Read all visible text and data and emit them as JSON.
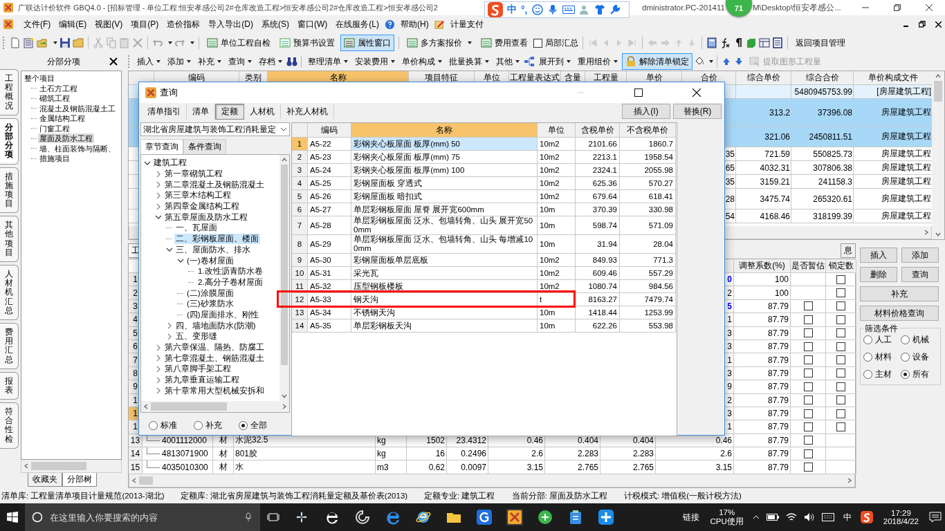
{
  "title_bar": {
    "title": "广联达计价软件 GBQ4.0 - [招标管理 - 单位工程:恒安孝感公司2#仓库改造工程>恒安孝感公司2#仓库改造工程>恒安孝感公司2",
    "title_tail": "dministrator.PC-201411",
    "title_end": "M\\Desktop\\恒安孝感公..."
  },
  "ime_toolbar": {
    "mode": "中",
    "punctuation": "°,"
  },
  "badge": "71",
  "menu": [
    "文件(F)",
    "编辑(E)",
    "视图(V)",
    "项目(P)",
    "造价指标",
    "导入导出(D)",
    "系统(S)",
    "窗口(W)",
    "在线服务(L)",
    "帮助(H)",
    "计量支付"
  ],
  "toolbar": [
    {
      "label": "单位工程自检",
      "pressed": false
    },
    {
      "label": "预算书设置",
      "pressed": false
    },
    {
      "label": "属性窗口",
      "pressed": true
    },
    {
      "label": "多方案报价",
      "pressed": false
    },
    {
      "label": "费用查看",
      "pressed": false
    }
  ],
  "partial_summary": {
    "label": "局部汇总",
    "checked": false
  },
  "return_button": "返回项目管理",
  "left_panel": {
    "title": "分部分项",
    "tree": [
      {
        "label": "整个项目",
        "selected": false,
        "children": [
          {
            "label": "土石方工程",
            "selected": false
          },
          {
            "label": "砌筑工程",
            "selected": false
          },
          {
            "label": "混凝土及钢筋混凝土工",
            "selected": false
          },
          {
            "label": "金属结构工程",
            "selected": false
          },
          {
            "label": "门窗工程",
            "selected": false
          },
          {
            "label": "屋面及防水工程",
            "selected": true
          },
          {
            "label": "墙、柱面装饰与隔断、",
            "selected": false
          },
          {
            "label": "措施项目",
            "selected": false
          }
        ]
      }
    ],
    "bottom_tabs": [
      {
        "label": "收藏夹",
        "selected": false
      },
      {
        "label": "分部树",
        "selected": true
      }
    ]
  },
  "side_tabs": [
    {
      "label": "工程概况",
      "selected": false
    },
    {
      "label": "分部分项",
      "selected": true
    },
    {
      "label": "措施项目",
      "selected": false
    },
    {
      "label": "其他项目",
      "selected": false
    },
    {
      "label": "人材机汇总",
      "selected": false
    },
    {
      "label": "费用汇总",
      "selected": false
    },
    {
      "label": "报表",
      "selected": false
    },
    {
      "label": "符合性检",
      "selected": false
    }
  ],
  "toolbar2": [
    {
      "label": "插入",
      "dropdown": true
    },
    {
      "label": "添加",
      "dropdown": true
    },
    {
      "label": "补充",
      "dropdown": true
    },
    {
      "label": "查询",
      "dropdown": true
    },
    {
      "label": "存档",
      "dropdown": true
    },
    {
      "label": "整理清单",
      "dropdown": true
    },
    {
      "label": "安装费用",
      "dropdown": true
    },
    {
      "label": "单价构成",
      "dropdown": true
    },
    {
      "label": "批量换算",
      "dropdown": true
    },
    {
      "label": "其他",
      "dropdown": true
    },
    {
      "label": "展开到",
      "dropdown": true
    },
    {
      "label": "重用组价",
      "dropdown": true
    }
  ],
  "unlock_button": {
    "label": "解除清单锁定",
    "pressed": true
  },
  "extract_button": {
    "label": "提取图形工程量",
    "disabled": true
  },
  "top_grid": {
    "columns": [
      {
        "label": "编码",
        "selected": false
      },
      {
        "label": "类别",
        "selected": false
      },
      {
        "label": "名称",
        "selected": true
      },
      {
        "label": "项目特征",
        "selected": false
      },
      {
        "label": "单位",
        "selected": false
      },
      {
        "label": "工程量表达式",
        "selected": false
      },
      {
        "label": "含量",
        "selected": false
      },
      {
        "label": "工程量",
        "selected": false
      },
      {
        "label": "单价",
        "selected": false
      },
      {
        "label": "合价",
        "selected": false
      },
      {
        "label": "综合单价",
        "selected": false
      },
      {
        "label": "综合合价",
        "selected": false
      },
      {
        "label": "单价构成文件",
        "selected": false
      }
    ],
    "rows": [
      {
        "kind": "total",
        "selected": false,
        "total": "5480945753.99",
        "file": "[房屋建筑工程]"
      },
      {
        "kind": "item",
        "selected": true,
        "unit_price": "313.2",
        "total": "37396.08",
        "file": "房屋建筑工程"
      },
      {
        "kind": "item",
        "selected": true,
        "unit_price": "321.06",
        "total": "2450811.51",
        "file": "房屋建筑工程"
      },
      {
        "kind": "item",
        "selected": false,
        "amount": "35",
        "unit_price": "721.59",
        "total": "550825.73",
        "file": "房屋建筑工程"
      },
      {
        "kind": "item",
        "selected": false,
        "amount": "65",
        "unit_price": "4032.31",
        "total": "307806.38",
        "file": "房屋建筑工程"
      },
      {
        "kind": "item",
        "selected": false,
        "amount": "35",
        "unit_price": "3159.21",
        "total": "241158.3",
        "file": "房屋建筑工程"
      },
      {
        "kind": "item",
        "selected": false,
        "amount": "28",
        "unit_price": "3475.74",
        "total": "265320.61",
        "file": "房屋建筑工程"
      },
      {
        "kind": "item",
        "selected": false,
        "amount": "54",
        "unit_price": "4168.46",
        "total": "318199.39",
        "file": "房屋建筑工程"
      }
    ]
  },
  "bottom_tabs": [
    {
      "label": "工",
      "selected": true
    },
    {
      "label": "息",
      "selected": false
    }
  ],
  "bottom_grid": {
    "columns": [
      "调整系数(%)",
      "是否暂估",
      "锁定数"
    ],
    "rows": [
      {
        "no": "1",
        "selected": false,
        "tail": "0",
        "changed": true,
        "rate": "100",
        "lock": {
          "checked": false
        }
      },
      {
        "no": "2",
        "selected": false,
        "tail": "2",
        "changed": false,
        "rate": "100",
        "lock": {
          "checked": false
        }
      },
      {
        "no": "3",
        "selected": false,
        "tail": "5",
        "changed": true,
        "rate": "87.79",
        "estimate": {
          "checked": false
        },
        "lock": {
          "checked": false
        }
      },
      {
        "no": "4",
        "selected": false,
        "tail": "1",
        "changed": false,
        "rate": "87.79",
        "estimate": {
          "checked": false
        },
        "lock": {
          "checked": false
        }
      },
      {
        "no": "5",
        "selected": false,
        "tail": "3",
        "changed": false,
        "rate": "87.79",
        "estimate": {
          "checked": false
        },
        "lock": {
          "checked": false
        }
      },
      {
        "no": "6",
        "selected": false,
        "tail": "3",
        "changed": false,
        "rate": "87.79",
        "estimate": {
          "checked": false
        },
        "lock": {
          "checked": false
        }
      },
      {
        "no": "7",
        "selected": false,
        "tail": "1",
        "changed": false,
        "rate": "87.79",
        "estimate": {
          "checked": false
        },
        "lock": {
          "checked": false
        }
      },
      {
        "no": "8",
        "selected": false,
        "tail": "3",
        "changed": false,
        "rate": "87.79",
        "estimate": {
          "checked": false
        },
        "lock": {
          "checked": false
        }
      },
      {
        "no": "9",
        "selected": false,
        "tail": "9",
        "changed": false,
        "rate": "87.79",
        "estimate": {
          "checked": false
        },
        "lock": {
          "checked": false
        }
      },
      {
        "no": "1",
        "selected": false,
        "tail": "2",
        "changed": false,
        "rate": "87.79",
        "estimate": {
          "checked": false
        },
        "lock": {
          "checked": false
        }
      },
      {
        "no": "1",
        "selected": true,
        "tail": "3",
        "changed": false,
        "rate": "87.79",
        "estimate": {
          "checked": false
        },
        "lock": {
          "checked": false
        }
      },
      {
        "no": "1",
        "selected": false,
        "tail": "1",
        "changed": false,
        "rate": "87.79",
        "estimate": {
          "checked": false
        },
        "lock": {
          "checked": false
        }
      },
      {
        "no": "13",
        "selected": false,
        "code": "4001112000",
        "type": "材",
        "name": "水泥32.5",
        "unit": "kg",
        "qty": "1502",
        "content": "23.4312",
        "price1": "0.46",
        "price2": "0.404",
        "price3": "0.404",
        "tail": "0.46",
        "changed": false,
        "rate": "87.79",
        "estimate": {
          "checked": false
        }
      },
      {
        "no": "14",
        "selected": false,
        "code": "4813071900",
        "type": "材",
        "name": "801胶",
        "unit": "kg",
        "qty": "16",
        "content": "0.2496",
        "price1": "2.6",
        "price2": "2.283",
        "price3": "2.283",
        "tail": "2.6",
        "changed": false,
        "rate": "87.79",
        "estimate": {
          "checked": false
        }
      },
      {
        "no": "15",
        "selected": false,
        "code": "4035010300",
        "type": "材",
        "name": "水",
        "unit": "m3",
        "qty": "0.62",
        "content": "0.0097",
        "price1": "3.15",
        "price2": "2.765",
        "price3": "2.765",
        "tail": "3.15",
        "changed": false,
        "rate": "87.79",
        "estimate": {
          "checked": false
        }
      }
    ]
  },
  "side_buttons": [
    "插入",
    "添加",
    "删除",
    "查询",
    "补充",
    "材料价格查询"
  ],
  "filter": {
    "title": "筛选条件",
    "options": [
      {
        "label": "人工",
        "selected": false
      },
      {
        "label": "机械",
        "selected": false
      },
      {
        "label": "材料",
        "selected": false
      },
      {
        "label": "设备",
        "selected": false
      },
      {
        "label": "主材",
        "selected": false
      },
      {
        "label": "所有",
        "selected": true
      }
    ]
  },
  "dialog": {
    "title": "查询",
    "tabs": [
      {
        "label": "清单指引",
        "selected": false
      },
      {
        "label": "清单",
        "selected": false
      },
      {
        "label": "定额",
        "selected": true
      },
      {
        "label": "人材机",
        "selected": false
      },
      {
        "label": "补充人材机",
        "selected": false
      }
    ],
    "buttons": [
      "插入(I)",
      "替换(R)"
    ],
    "library": "湖北省房屋建筑与装饰工程消耗量定",
    "search_tabs": [
      {
        "label": "章节查询",
        "selected": true
      },
      {
        "label": "条件查询",
        "selected": false
      }
    ],
    "tree": [
      {
        "label": "建筑工程",
        "expanded": true,
        "selected": false,
        "children": [
          {
            "label": "第一章砌筑工程",
            "expanded": false,
            "selected": false
          },
          {
            "label": "第二章混凝土及钢筋混凝土",
            "expanded": false,
            "selected": false
          },
          {
            "label": "第三章木结构工程",
            "expanded": false,
            "selected": false
          },
          {
            "label": "第四章金属结构工程",
            "expanded": false,
            "selected": false
          },
          {
            "label": "第五章屋面及防水工程",
            "expanded": true,
            "selected": false,
            "children": [
              {
                "label": "一、瓦屋面",
                "selected": false
              },
              {
                "label": "二、彩钢板屋面、楼面",
                "selected": true
              },
              {
                "label": "三、屋面防水、排水",
                "expanded": true,
                "selected": false,
                "children": [
                  {
                    "label": "(一)卷材屋面",
                    "expanded": true,
                    "selected": false,
                    "children": [
                      {
                        "label": "1.改性沥青防水卷",
                        "selected": false
                      },
                      {
                        "label": "2.高分子卷材屋面",
                        "selected": false
                      }
                    ]
                  },
                  {
                    "label": "(二)涂膜屋面",
                    "selected": false
                  },
                  {
                    "label": "(三)砂浆防水",
                    "selected": false
                  },
                  {
                    "label": "(四)屋面排水、刚性",
                    "selected": false
                  }
                ]
              },
              {
                "label": "四、墙地面防水(防潮)",
                "expanded": false,
                "selected": false
              },
              {
                "label": "五、变形缝",
                "expanded": false,
                "selected": false
              }
            ]
          },
          {
            "label": "第六章保温、隔热、防腐工",
            "expanded": false,
            "selected": false
          },
          {
            "label": "第七章混凝土、钢筋混凝土",
            "expanded": false,
            "selected": false
          },
          {
            "label": "第八章脚手架工程",
            "expanded": false,
            "selected": false
          },
          {
            "label": "第九章垂直运输工程",
            "expanded": false,
            "selected": false
          },
          {
            "label": "第十章常用大型机械安拆和",
            "expanded": false,
            "selected": false
          }
        ]
      }
    ],
    "scope": [
      {
        "label": "标准",
        "selected": false
      },
      {
        "label": "补充",
        "selected": false
      },
      {
        "label": "全部",
        "selected": true
      }
    ],
    "table": {
      "columns": [
        "编码",
        "名称",
        "单位",
        "含税单价",
        "不含税单价"
      ],
      "rows": [
        {
          "no": "1",
          "code": "A5-22",
          "name": "彩钢夹心板屋面 板厚(mm) 50",
          "unit": "10m2",
          "price_tax": "2101.66",
          "price": "1860.7",
          "selected": true
        },
        {
          "no": "2",
          "code": "A5-23",
          "name": "彩钢夹心板屋面 板厚(mm) 75",
          "unit": "10m2",
          "price_tax": "2213.1",
          "price": "1958.54",
          "selected": false
        },
        {
          "no": "3",
          "code": "A5-24",
          "name": "彩钢夹心板屋面 板厚(mm) 100",
          "unit": "10m2",
          "price_tax": "2324.1",
          "price": "2055.98",
          "selected": false
        },
        {
          "no": "4",
          "code": "A5-25",
          "name": "彩钢屋面板 穿透式",
          "unit": "10m2",
          "price_tax": "625.36",
          "price": "570.27",
          "selected": false
        },
        {
          "no": "5",
          "code": "A5-26",
          "name": "彩钢屋面板 暗扣式",
          "unit": "10m2",
          "price_tax": "679.64",
          "price": "618.41",
          "selected": false
        },
        {
          "no": "6",
          "code": "A5-27",
          "name": "单层彩钢板屋面 屋脊 展开宽600mm",
          "unit": "10m",
          "price_tax": "370.39",
          "price": "330.98",
          "selected": false
        },
        {
          "no": "7",
          "code": "A5-28",
          "name": "单层彩钢板屋面 泛水、包墙转角、山头 展开宽500mm",
          "unit": "10m",
          "price_tax": "598.74",
          "price": "571.09",
          "selected": false
        },
        {
          "no": "8",
          "code": "A5-29",
          "name": "单层彩钢板屋面 泛水、包墙转角、山头 每增减100mm",
          "unit": "10m",
          "price_tax": "31.94",
          "price": "28.04",
          "selected": false
        },
        {
          "no": "9",
          "code": "A5-30",
          "name": "彩钢屋面板单层底板",
          "unit": "10m2",
          "price_tax": "849.93",
          "price": "771.3",
          "selected": false
        },
        {
          "no": "10",
          "code": "A5-31",
          "name": "采光瓦",
          "unit": "10m2",
          "price_tax": "609.46",
          "price": "557.29",
          "selected": false
        },
        {
          "no": "11",
          "code": "A5-32",
          "name": "压型钢板楼板",
          "unit": "10m2",
          "price_tax": "1080.74",
          "price": "984.56",
          "selected": false
        },
        {
          "no": "12",
          "code": "A5-33",
          "name": "钢天沟",
          "unit": "t",
          "price_tax": "8163.27",
          "price": "7479.74",
          "selected": false
        },
        {
          "no": "13",
          "code": "A5-34",
          "name": "不锈钢天沟",
          "unit": "10m",
          "price_tax": "1418.44",
          "price": "1253.99",
          "selected": false
        },
        {
          "no": "14",
          "code": "A5-35",
          "name": "单层彩钢板天沟",
          "unit": "10m",
          "price_tax": "622.26",
          "price": "553.98",
          "selected": false
        }
      ]
    }
  },
  "status_bar": [
    "清单库: 工程量清单项目计量规范(2013-湖北)",
    "定额库: 湖北省房屋建筑与装饰工程消耗量定额及基价表(2013)",
    "定额专业: 建筑工程",
    "当前分部: 屋面及防水工程",
    "计税模式: 增值税(一般计税方法)"
  ],
  "taskbar": {
    "search_placeholder": "在这里输入你要搜索的内容",
    "links": "链接",
    "cpu_value": "17%",
    "cpu_label": "CPU使用",
    "ime": "中",
    "time": "17:29",
    "date": "2018/4/22"
  }
}
